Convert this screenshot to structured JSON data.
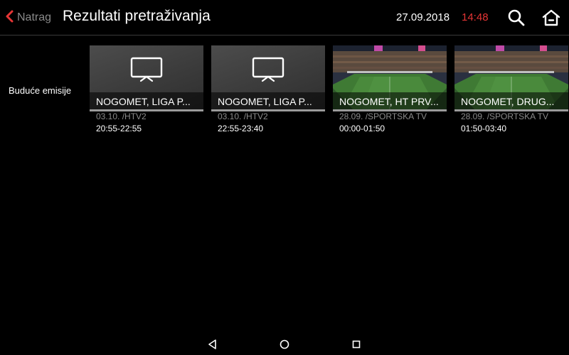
{
  "header": {
    "back_label": "Natrag",
    "title": "Rezultati pretraživanja",
    "date": "27.09.2018",
    "time": "14:48",
    "time_color": "#e63535",
    "accent_color": "#e63535"
  },
  "section": {
    "label": "Buduće emisije"
  },
  "results": [
    {
      "title": "NOGOMET, LIGA P...",
      "meta": "03.10. /HTV2",
      "time_range": "20:55-22:55",
      "thumbnail": "tv-placeholder-icon"
    },
    {
      "title": "NOGOMET, LIGA P...",
      "meta": "03.10. /HTV2",
      "time_range": "22:55-23:40",
      "thumbnail": "tv-placeholder-icon"
    },
    {
      "title": "NOGOMET, HT PRV...",
      "meta": "28.09. /SPORTSKA TV",
      "time_range": "00:00-01:50",
      "thumbnail": "stadium-image"
    },
    {
      "title": "NOGOMET, DRUG...",
      "meta": "28.09. /SPORTSKA TV",
      "time_range": "01:50-03:40",
      "thumbnail": "stadium-image"
    }
  ],
  "icons": {
    "back": "chevron-left-icon",
    "search": "search-icon",
    "home": "home-icon",
    "nav_back": "triangle-back-icon",
    "nav_home": "circle-home-icon",
    "nav_recents": "square-recents-icon"
  }
}
